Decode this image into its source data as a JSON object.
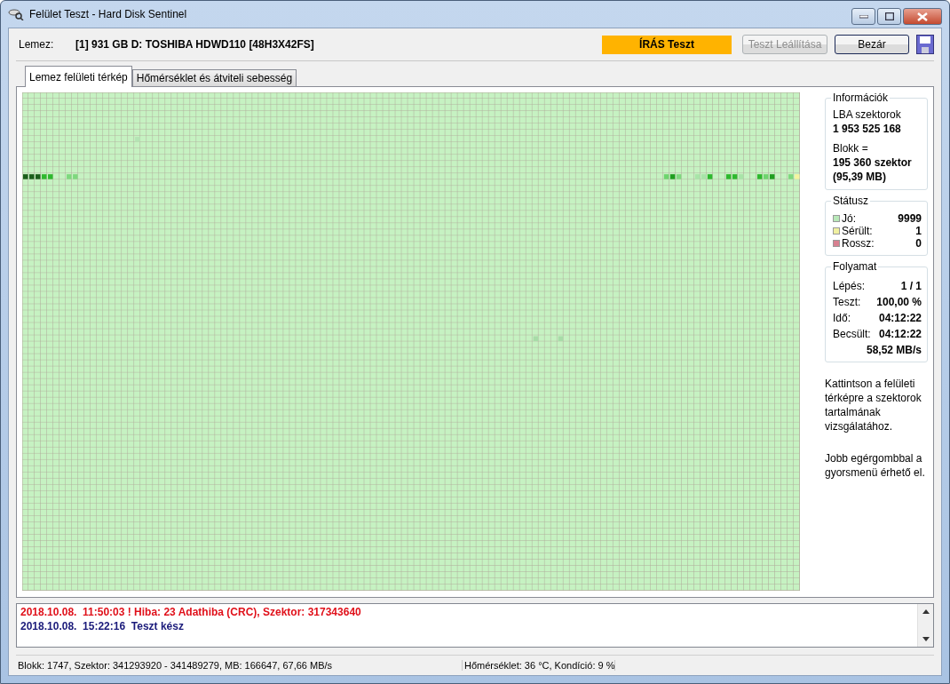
{
  "window": {
    "title": "Felület Teszt - Hard Disk Sentinel"
  },
  "disk": {
    "label": "Lemez:",
    "value": "[1] 931 GB D: TOSHIBA HDWD110 [48H3X42FS]"
  },
  "mode_badge": "ÍRÁS Teszt",
  "buttons": [
    {
      "label": "Teszt Leállítása",
      "disabled": true
    },
    {
      "label": "Bezár",
      "disabled": false
    }
  ],
  "tabs": [
    {
      "label": "Lemez felületi térkép",
      "selected": true
    },
    {
      "label": "Hőmérséklet és átviteli sebesség",
      "selected": false
    }
  ],
  "info": {
    "title": "Információk",
    "lba_label": "LBA szektorok",
    "lba_value": "1 953 525 168",
    "block_label": "Blokk =",
    "block_value": "195 360 szektor",
    "block_mb": "(95,39 MB)"
  },
  "status": {
    "title": "Státusz",
    "items": [
      {
        "label": "Jó:",
        "value": "9999",
        "color": "#b8e8b8"
      },
      {
        "label": "Sérült:",
        "value": "1",
        "color": "#f0f0a0"
      },
      {
        "label": "Rossz:",
        "value": "0",
        "color": "#d88090"
      }
    ]
  },
  "progress": {
    "title": "Folyamat",
    "rows": [
      {
        "label": "Lépés:",
        "value": "1 / 1"
      },
      {
        "label": "Teszt:",
        "value": "100,00 %"
      },
      {
        "label": "Idő:",
        "value": "04:12:22"
      },
      {
        "label": "Becsült:",
        "value": "04:12:22"
      }
    ],
    "speed": "58,52 MB/s"
  },
  "help": [
    "Kattintson a felületi térképre a szektorok tartalmának vizsgálatához.",
    "Jobb egérgombbal a gyorsmenü érhető el."
  ],
  "log": [
    {
      "kind": "error",
      "text": "2018.10.08.  11:50:03 ! Hiba: 23 Adathiba (CRC), Szektor: 317343640"
    },
    {
      "kind": "info",
      "text": "2018.10.08.  15:22:16  Teszt kész"
    }
  ],
  "status_bar": [
    "Blokk: 1747, Szektor: 341293920 - 341489279, MB: 166647, 67,66 MB/s",
    "Hőmérséklet: 36  °C,  Kondíció: 9 %"
  ]
}
